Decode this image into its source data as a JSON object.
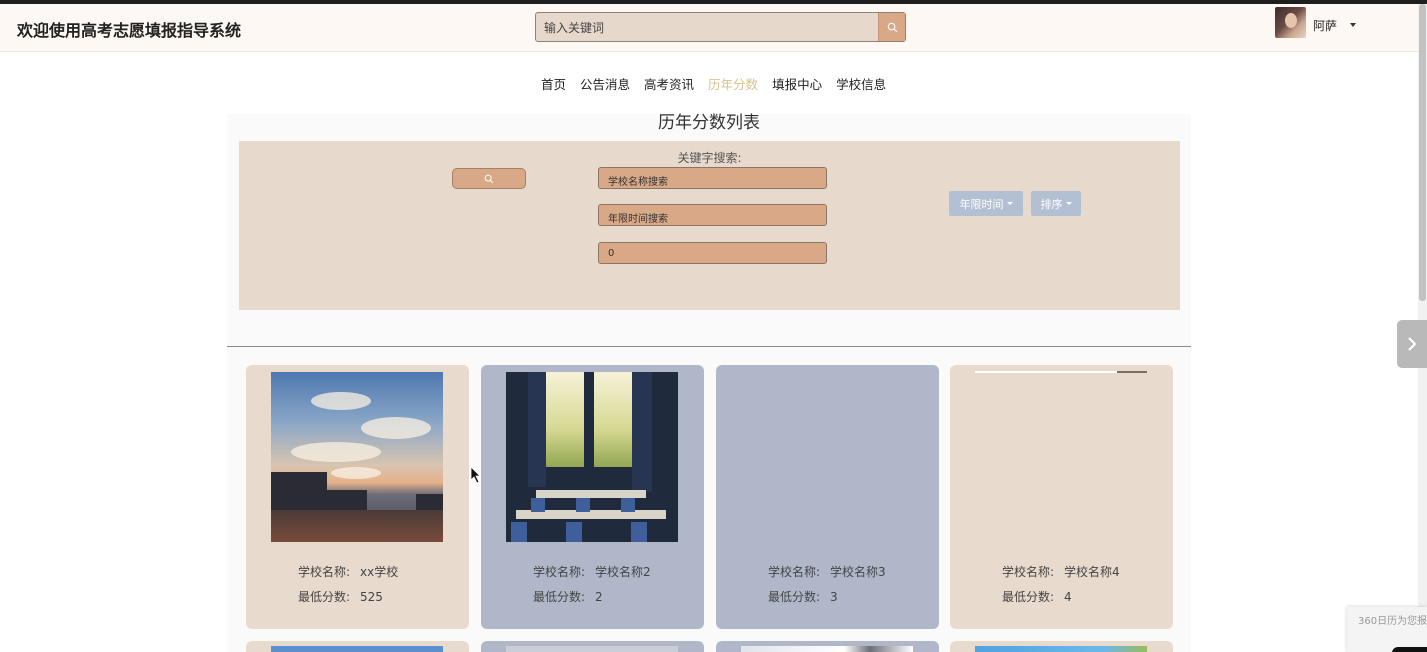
{
  "header": {
    "title": "欢迎使用高考志愿填报指导系统",
    "search_placeholder": "输入关键词",
    "username": "阿萨"
  },
  "nav": {
    "items": [
      {
        "label": "首页",
        "active": false
      },
      {
        "label": "公告消息",
        "active": false
      },
      {
        "label": "高考资讯",
        "active": false
      },
      {
        "label": "历年分数",
        "active": true
      },
      {
        "label": "填报中心",
        "active": false
      },
      {
        "label": "学校信息",
        "active": false
      }
    ]
  },
  "main": {
    "list_title": "历年分数列表",
    "search": {
      "keyword_label": "关键字搜索:",
      "school_name_placeholder": "学校名称搜索",
      "year_placeholder": "年限时间搜索",
      "score_value": "0",
      "dropdown_year_label": "年限时间",
      "dropdown_sort_label": "排序"
    },
    "cards": [
      {
        "school_label": "学校名称:",
        "school_name": "xx学校",
        "score_label": "最低分数:",
        "score": "525"
      },
      {
        "school_label": "学校名称:",
        "school_name": "学校名称2",
        "score_label": "最低分数:",
        "score": "2"
      },
      {
        "school_label": "学校名称:",
        "school_name": "学校名称3",
        "score_label": "最低分数:",
        "score": "3"
      },
      {
        "school_label": "学校名称:",
        "school_name": "学校名称4",
        "score_label": "最低分数:",
        "score": "4"
      }
    ]
  },
  "promo": {
    "text": "360日历为您报"
  },
  "colors": {
    "header_bg": "#fdf8f4",
    "accent_orange": "#d9a887",
    "panel_beige": "#e7dacd",
    "card_blue": "#afb7c8",
    "dropdown_blue": "#b3bfd3",
    "nav_active": "#d8c28b"
  }
}
